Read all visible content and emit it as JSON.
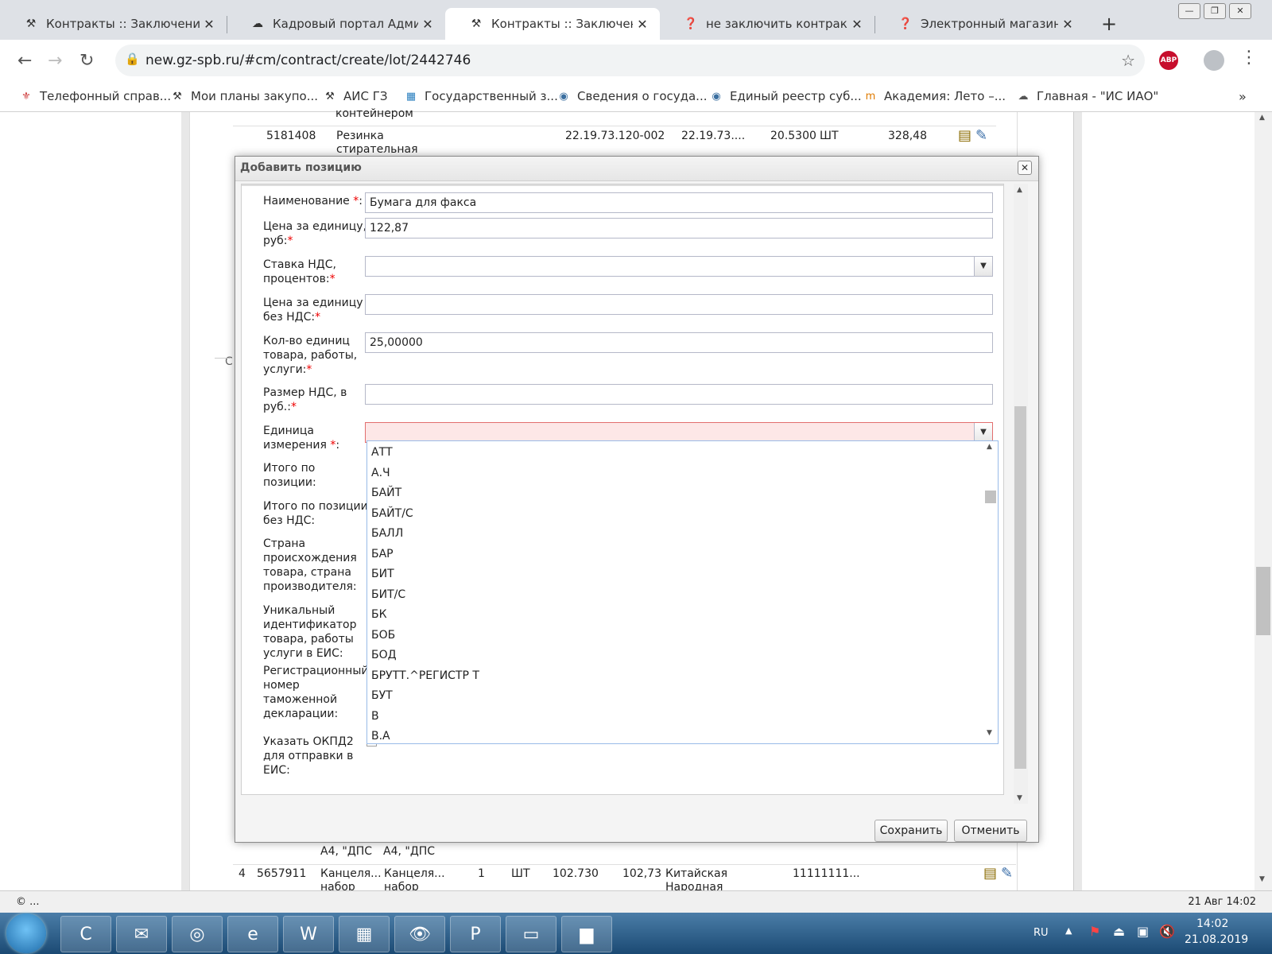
{
  "browser": {
    "tabs": [
      {
        "title": "Контракты :: Заключение до",
        "icon": "gavel-icon"
      },
      {
        "title": "Кадровый портал Админист",
        "icon": "portal-icon"
      },
      {
        "title": "Контракты :: Заключение до",
        "icon": "gavel-icon",
        "active": true
      },
      {
        "title": "не заключить контракт | Не",
        "icon": "help-icon"
      },
      {
        "title": "Электронный магазин: при",
        "icon": "help-icon"
      }
    ],
    "url": "new.gz-spb.ru/#cm/contract/create/lot/2442746",
    "bookmarks": [
      "Телефонный справ...",
      "Мои планы закупо...",
      "АИС ГЗ",
      "Государственный з...",
      "Сведения о госуда...",
      "Единый реестр суб...",
      "Академия: Лето –...",
      "Главная - \"ИС ИАО\""
    ],
    "abp_label": "ABP",
    "more_bookmarks": "»"
  },
  "background": {
    "row_top": {
      "text": "контейнером"
    },
    "row1": {
      "id": "5181408",
      "name_line1": "Резинка",
      "name_line2": "стирательная",
      "code1": "22.19.73.120-002",
      "code2": "22.19.73....",
      "price_code": "20.5300",
      "unit": "ШТ",
      "sum": "328,48"
    },
    "row_bottom": {
      "num": "4",
      "id": "5657911",
      "name1": "Канцеля...",
      "name1b": "набор",
      "name2": "Канцеля...",
      "name2b": "набор",
      "qty": "1",
      "unit": "ШТ",
      "p1": "102.730",
      "p2": "102,73",
      "country": "Китайская",
      "country2": "Народная",
      "code": "11111111..."
    },
    "above_bottom": {
      "a": "А4, \"ДПС",
      "b": "А4, \"ДПС"
    },
    "status_left": "© ...",
    "status_right": "21 Авг 14:02",
    "side_letter": "С"
  },
  "dialog": {
    "title": "Добавить позицию",
    "fields": {
      "name": {
        "label": "Наименование",
        "value": "Бумага для факса"
      },
      "price": {
        "label1": "Цена за единицу,",
        "label2": "руб:",
        "value": "122,87"
      },
      "vat_rate": {
        "label1": "Ставка НДС,",
        "label2": "процентов:",
        "value": ""
      },
      "price_no_vat": {
        "label1": "Цена за единицу",
        "label2": "без НДС:",
        "value": ""
      },
      "qty": {
        "label1": "Кол-во единиц",
        "label2": "товара, работы,",
        "label3": "услуги:",
        "value": "25,00000"
      },
      "vat_sum": {
        "label1": "Размер НДС, в",
        "label2": "руб.:",
        "value": ""
      },
      "unit": {
        "label1": "Единица",
        "label2": "измерения",
        "value": ""
      },
      "total": {
        "label1": "Итого по",
        "label2": "позиции:"
      },
      "total_no_vat": {
        "label1": "Итого по позиции",
        "label2": "без НДС:"
      },
      "country": {
        "label1": "Страна",
        "label2": "происхождения",
        "label3": "товара, страна",
        "label4": "производителя:"
      },
      "uid": {
        "label1": "Уникальный",
        "label2": "идентификатор",
        "label3": "товара, работы",
        "label4": "услуги в ЕИС:"
      },
      "customs": {
        "label1": "Регистрационный",
        "label2": "номер",
        "label3": "таможенной",
        "label4": "декларации:"
      },
      "okpd": {
        "label1": "Указать ОКПД2",
        "label2": "для отправки в",
        "label3": "ЕИС:"
      }
    },
    "required_mark": "*",
    "unit_options": [
      "АТТ",
      "А.Ч",
      "БАЙТ",
      "БАЙТ/С",
      "БАЛЛ",
      "БАР",
      "БИТ",
      "БИТ/С",
      "БК",
      "БОБ",
      "БОД",
      "БРУТТ.^РЕГИСТР Т",
      "БУТ",
      "В",
      "В.А"
    ],
    "save_label": "Сохранить",
    "cancel_label": "Отменить"
  },
  "taskbar": {
    "lang": "RU",
    "time": "14:02",
    "date": "21.08.2019",
    "apps": [
      "ccleaner-icon",
      "mail-icon",
      "chrome-icon",
      "ie-icon",
      "word-icon",
      "calc-icon",
      "eye-icon",
      "pdf-icon",
      "scanner-icon",
      "explorer-icon"
    ]
  },
  "colors": {
    "accent": "#1a73e8",
    "required": "#e00000",
    "error_bg": "#fde7e7"
  }
}
